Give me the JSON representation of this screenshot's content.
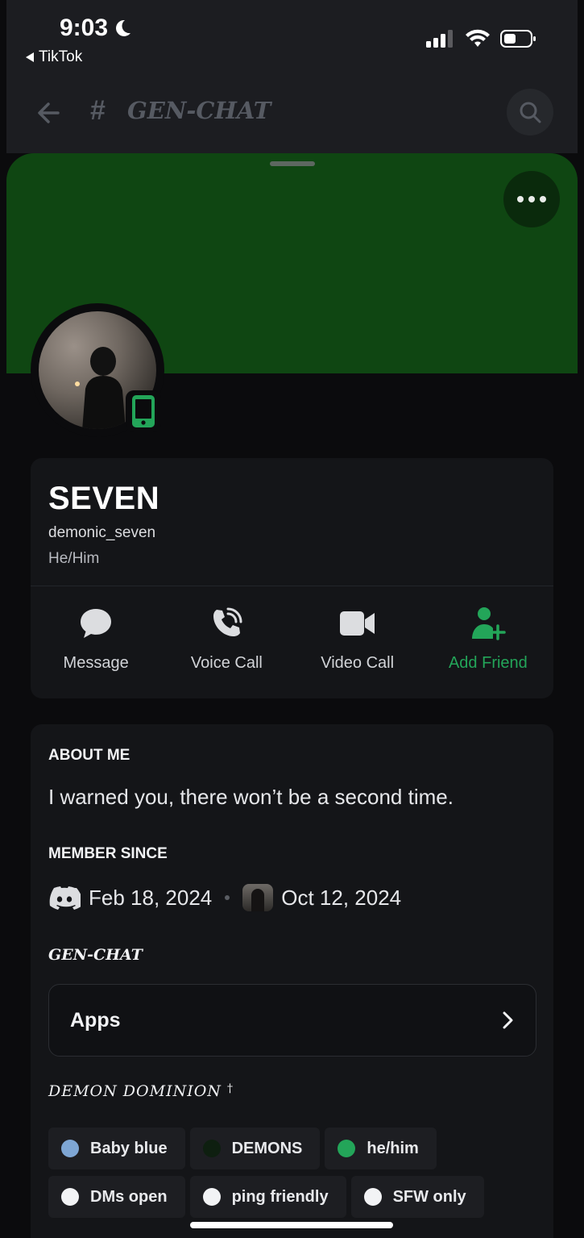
{
  "status": {
    "time": "9:03",
    "back_app": "TikTok"
  },
  "nav": {
    "hash": "#",
    "channel": "GEN-CHAT"
  },
  "profile": {
    "display_name": "SEVEN",
    "username": "demonic_seven",
    "pronouns": "He/Him",
    "banner_color": "#0f4612",
    "status": "mobile-online"
  },
  "actions": [
    {
      "label": "Message",
      "icon": "message-bubble-icon"
    },
    {
      "label": "Voice Call",
      "icon": "phone-call-icon"
    },
    {
      "label": "Video Call",
      "icon": "video-camera-icon"
    },
    {
      "label": "Add Friend",
      "icon": "add-friend-icon",
      "color": "#23a559"
    }
  ],
  "about": {
    "heading": "ABOUT ME",
    "text": "I warned you, there won’t be a second time."
  },
  "member_since": {
    "heading": "MEMBER SINCE",
    "discord_date": "Feb 18, 2024",
    "server_date": "Oct 12, 2024"
  },
  "server_section": {
    "heading": "GEN-CHAT",
    "apps_label": "Apps"
  },
  "roles_section": {
    "heading": "DEMON DOMINION",
    "badge": "†",
    "rows": [
      [
        {
          "name": "Baby blue",
          "color": "#7ea6d4"
        },
        {
          "name": "DEMONS",
          "color": "#0e1f10"
        },
        {
          "name": "he/him",
          "color": "#23a559"
        }
      ],
      [
        {
          "name": "DMs open",
          "color": "#f2f3f5"
        },
        {
          "name": "ping friendly",
          "color": "#f2f3f5"
        },
        {
          "name": "SFW only",
          "color": "#f2f3f5"
        }
      ]
    ]
  }
}
